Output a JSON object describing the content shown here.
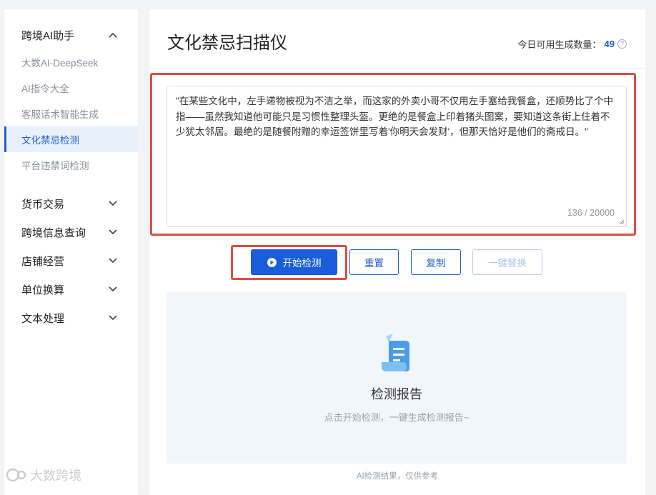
{
  "sidebar": {
    "groups": [
      {
        "label": "跨境AI助手",
        "expanded": true,
        "items": [
          "大数AI-DeepSeek",
          "AI指令大全",
          "客服话术智能生成",
          "文化禁忌检测",
          "平台违禁词检测"
        ]
      },
      {
        "label": "货币交易",
        "expanded": false
      },
      {
        "label": "跨境信息查询",
        "expanded": false
      },
      {
        "label": "店铺经营",
        "expanded": false
      },
      {
        "label": "单位换算",
        "expanded": false
      },
      {
        "label": "文本处理",
        "expanded": false
      }
    ],
    "active_item": "文化禁忌检测"
  },
  "main": {
    "title": "文化禁忌扫描仪",
    "quota_label": "今日可用生成数量：",
    "quota_value": "49",
    "input_text": "\"在某些文化中，左手递物被视为不洁之举，而这家的外卖小哥不仅用左手塞给我餐盒，还顺势比了个中指——虽然我知道他可能只是习惯性整理头盔。更绝的是餐盒上印着猪头图案，要知道这条街上住着不少犹太邻居。最绝的是随餐附赠的幸运签饼里写着'你明天会发财'，但那天恰好是他们的斋戒日。\"",
    "char_count": "136 / 20000",
    "buttons": {
      "start": "开始检测",
      "reset": "重置",
      "copy": "复制",
      "replace": "一键替换"
    },
    "report": {
      "title": "检测报告",
      "subtitle": "点击开始检测，一键生成检测报告~"
    },
    "footnote": "AI检测结果，仅供参考"
  },
  "watermark": "大数跨境",
  "colors": {
    "accent": "#1f5fc9",
    "primary_button": "#1a5cdb",
    "highlight_border": "#dc4e45",
    "report_bg": "#f1f6fd"
  }
}
